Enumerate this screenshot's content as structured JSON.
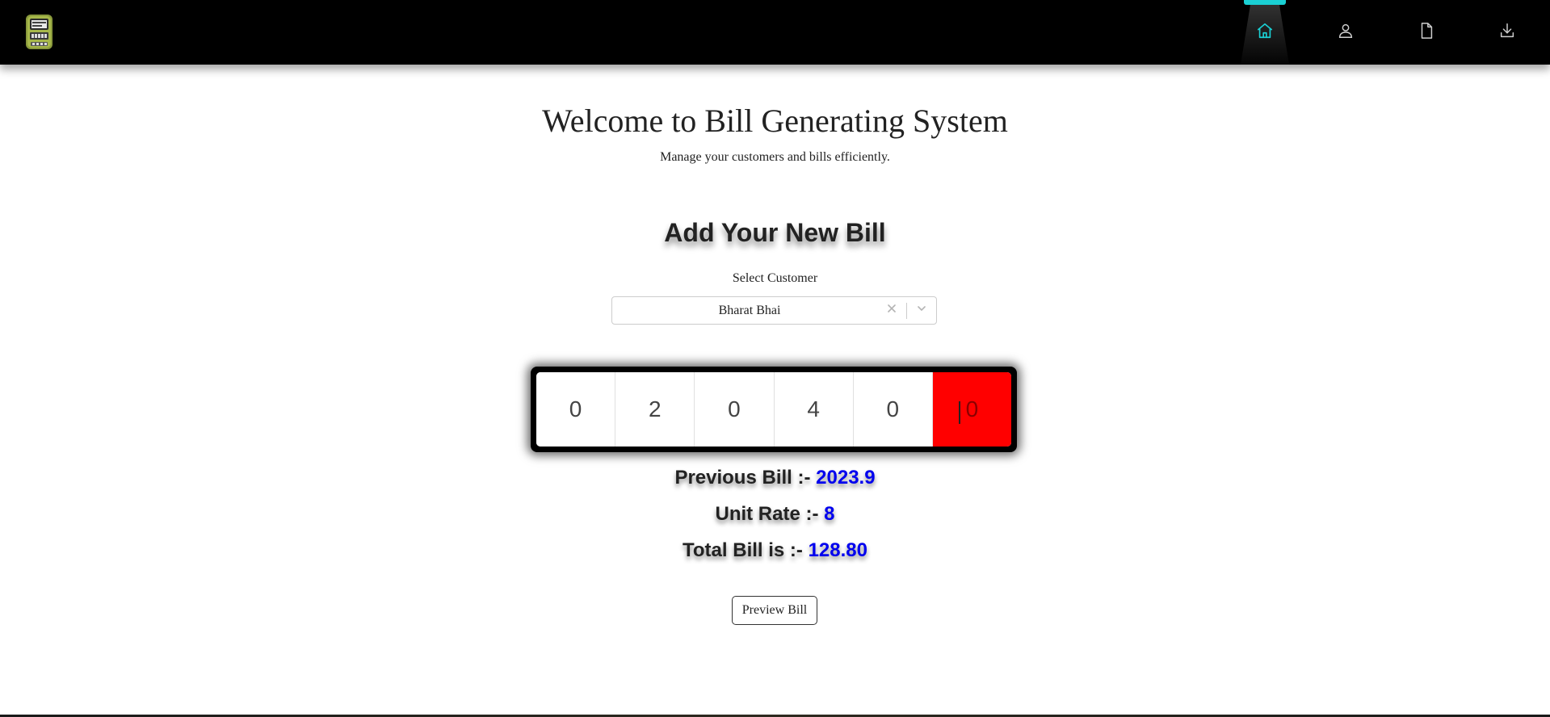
{
  "navbar": {
    "logo_icon": "electric-meter-logo",
    "items": [
      {
        "icon": "home-icon",
        "active": true
      },
      {
        "icon": "user-icon",
        "active": false
      },
      {
        "icon": "document-icon",
        "active": false
      },
      {
        "icon": "download-icon",
        "active": false
      }
    ],
    "active_color": "#1ad0d4"
  },
  "header": {
    "title": "Welcome to Bill Generating System",
    "subtitle": "Manage your customers and bills efficiently."
  },
  "form": {
    "title": "Add Your New Bill",
    "select_label": "Select Customer",
    "selected_customer": "Bharat Bhai"
  },
  "meter": {
    "digits": [
      "0",
      "2",
      "0",
      "4",
      "0",
      "0"
    ],
    "highlight_color": "#ff0000"
  },
  "bill": {
    "previous_label": "Previous Bill :-",
    "previous_value": "2023.9",
    "rate_label": "Unit Rate :-",
    "rate_value": "8",
    "total_label": "Total Bill is :-",
    "total_value": "128.80",
    "value_color": "#0000ee"
  },
  "actions": {
    "preview_label": "Preview Bill"
  }
}
